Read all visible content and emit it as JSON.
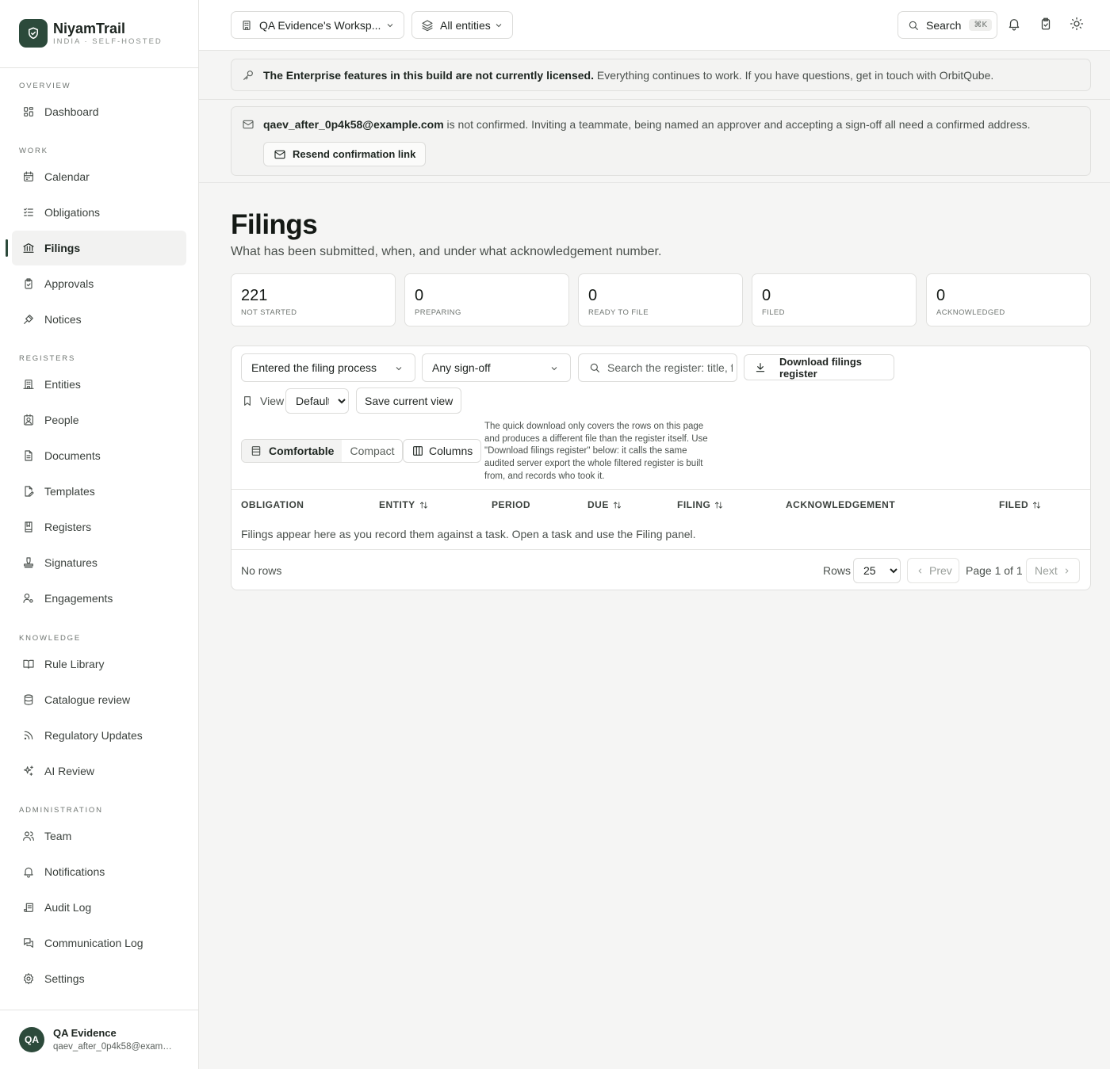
{
  "brand": {
    "name": "NiyamTrail",
    "sub": "INDIA · SELF-HOSTED"
  },
  "colors": {
    "accent": "#2c4a3b",
    "background": "#f5f5f4",
    "surface": "#ffffff",
    "border": "#e0e0de"
  },
  "nav": {
    "sections": [
      {
        "title": "OVERVIEW",
        "items": [
          {
            "label": "Dashboard",
            "icon": "grid-icon"
          }
        ]
      },
      {
        "title": "WORK",
        "items": [
          {
            "label": "Calendar",
            "icon": "calendar-icon"
          },
          {
            "label": "Obligations",
            "icon": "checklist-icon"
          },
          {
            "label": "Filings",
            "icon": "bank-icon",
            "active": true
          },
          {
            "label": "Approvals",
            "icon": "clipboard-check-icon"
          },
          {
            "label": "Notices",
            "icon": "gavel-icon"
          }
        ]
      },
      {
        "title": "REGISTERS",
        "items": [
          {
            "label": "Entities",
            "icon": "building-icon"
          },
          {
            "label": "People",
            "icon": "contact-icon"
          },
          {
            "label": "Documents",
            "icon": "document-icon"
          },
          {
            "label": "Templates",
            "icon": "file-edit-icon"
          },
          {
            "label": "Registers",
            "icon": "book-icon"
          },
          {
            "label": "Signatures",
            "icon": "stamp-icon"
          },
          {
            "label": "Engagements",
            "icon": "user-cog-icon"
          }
        ]
      },
      {
        "title": "KNOWLEDGE",
        "items": [
          {
            "label": "Rule Library",
            "icon": "open-book-icon"
          },
          {
            "label": "Catalogue review",
            "icon": "database-icon"
          },
          {
            "label": "Regulatory Updates",
            "icon": "rss-icon"
          },
          {
            "label": "AI Review",
            "icon": "sparkles-icon"
          }
        ]
      },
      {
        "title": "ADMINISTRATION",
        "items": [
          {
            "label": "Team",
            "icon": "users-icon"
          },
          {
            "label": "Notifications",
            "icon": "bell-icon"
          },
          {
            "label": "Audit Log",
            "icon": "scroll-icon"
          },
          {
            "label": "Communication Log",
            "icon": "messages-icon"
          },
          {
            "label": "Settings",
            "icon": "gear-icon"
          }
        ]
      }
    ]
  },
  "user": {
    "initials": "QA",
    "name": "QA Evidence",
    "email": "qaev_after_0p4k58@example.com"
  },
  "topbar": {
    "workspace": "QA Evidence's Worksp...",
    "entities": "All entities",
    "search_label": "Search",
    "search_shortcut": "⌘K"
  },
  "license_banner": {
    "strong": "The Enterprise features in this build are not currently licensed.",
    "text": " Everything continues to work. If you have questions, get in touch with OrbitQube."
  },
  "confirm_banner": {
    "email": "qaev_after_0p4k58@example.com",
    "text": " is not confirmed. Inviting a teammate, being named an approver and accepting a sign-off all need a confirmed address.",
    "button": "Resend confirmation link"
  },
  "page": {
    "title": "Filings",
    "subtitle": "What has been submitted, when, and under what acknowledgement number."
  },
  "stats": [
    {
      "value": "221",
      "label": "NOT STARTED"
    },
    {
      "value": "0",
      "label": "PREPARING"
    },
    {
      "value": "0",
      "label": "READY TO FILE"
    },
    {
      "value": "0",
      "label": "FILED"
    },
    {
      "value": "0",
      "label": "ACKNOWLEDGED"
    }
  ],
  "filters": {
    "stage": "Entered the filing process",
    "signoff": "Any sign-off",
    "search_placeholder": "Search the register: title, form, ack no.",
    "download": "Download filings register"
  },
  "view": {
    "label": "View",
    "selected": "Default",
    "save": "Save current view"
  },
  "density": {
    "comfortable": "Comfortable",
    "compact": "Compact",
    "columns": "Columns"
  },
  "note": "The quick download only covers the rows on this page and produces a different file than the register itself. Use \"Download filings register\" below: it calls the same audited server export the whole filtered register is built from, and records who took it.",
  "table": {
    "columns": [
      {
        "label": "OBLIGATION",
        "sortable": false
      },
      {
        "label": "ENTITY",
        "sortable": true
      },
      {
        "label": "PERIOD",
        "sortable": false
      },
      {
        "label": "DUE",
        "sortable": true
      },
      {
        "label": "FILING",
        "sortable": true
      },
      {
        "label": "ACKNOWLEDGEMENT",
        "sortable": false
      },
      {
        "label": "FILED",
        "sortable": true
      }
    ],
    "empty": "Filings appear here as you record them against a task. Open a task and use the Filing panel."
  },
  "footer": {
    "no_rows": "No rows",
    "rows_label": "Rows",
    "rows_value": "25",
    "prev": "Prev",
    "page": "Page 1 of 1",
    "next": "Next"
  }
}
